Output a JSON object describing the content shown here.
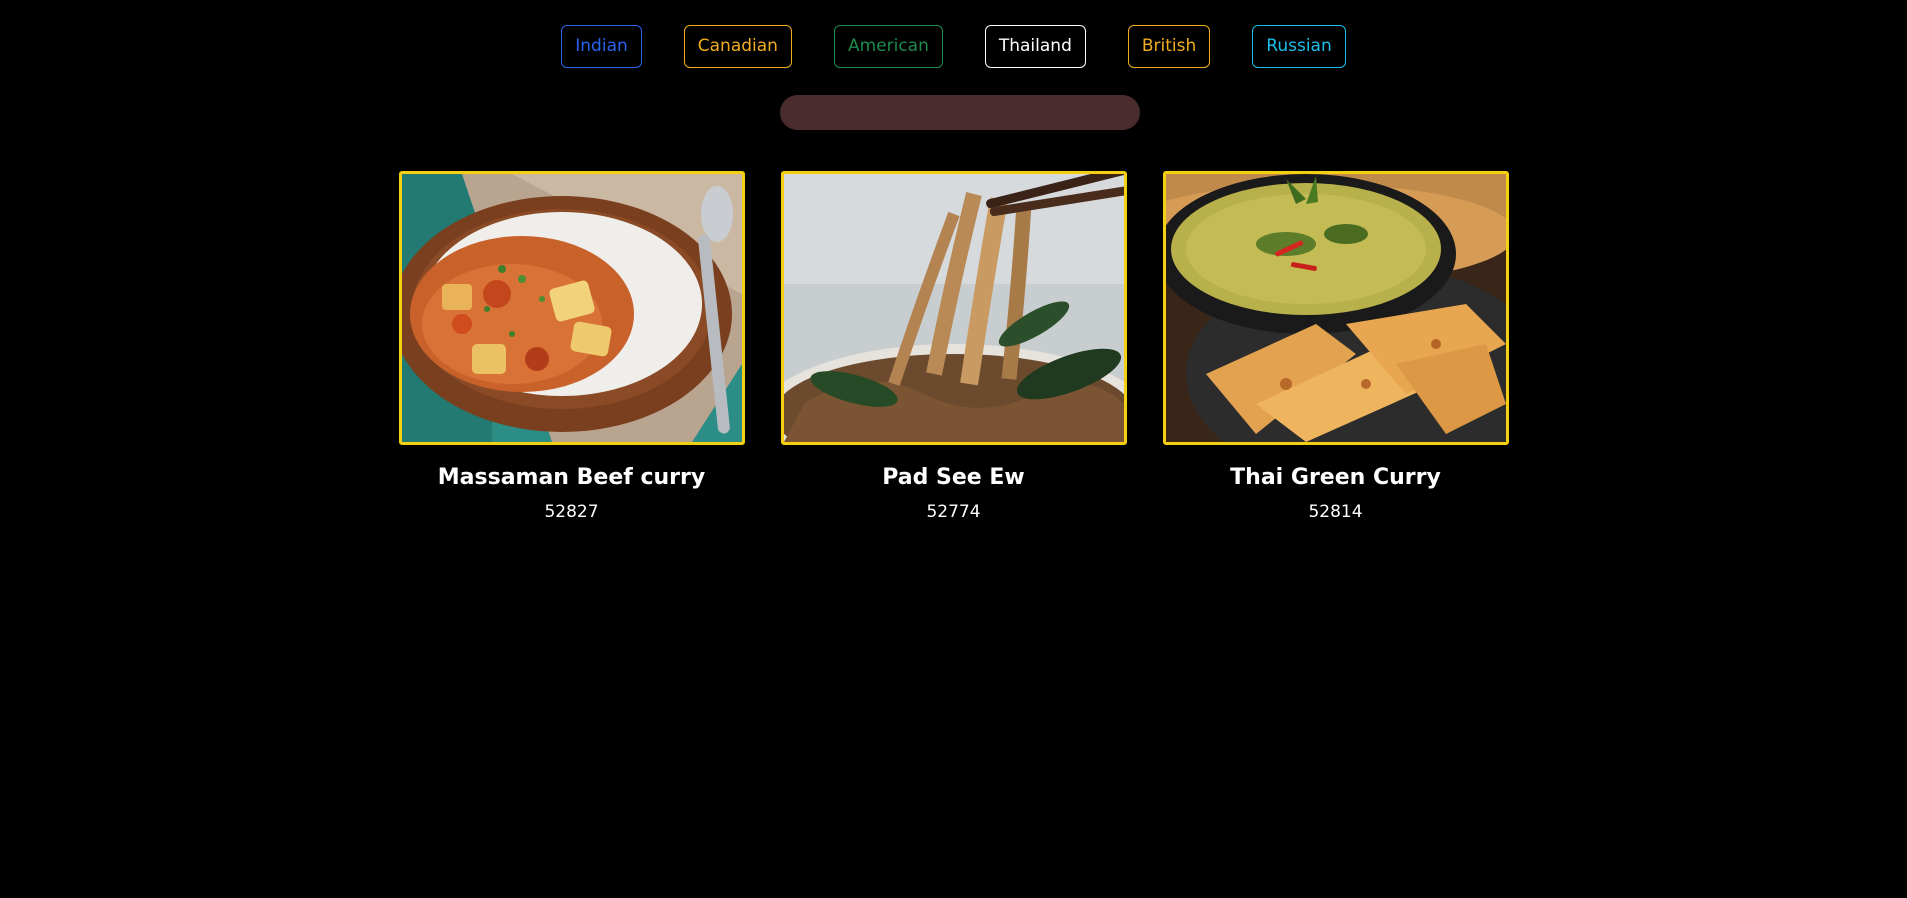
{
  "filters": [
    {
      "label": "Indian",
      "color": "#2a63f0"
    },
    {
      "label": "Canadian",
      "color": "#f0ad1e"
    },
    {
      "label": "American",
      "color": "#1d8a4e"
    },
    {
      "label": "Thailand",
      "color": "#ffffff"
    },
    {
      "label": "British",
      "color": "#f0ad1e"
    },
    {
      "label": "Russian",
      "color": "#1cbfe8"
    }
  ],
  "search": {
    "value": "",
    "placeholder": ""
  },
  "meals": [
    {
      "title": "Massaman Beef curry",
      "id": "52827"
    },
    {
      "title": "Pad See Ew",
      "id": "52774"
    },
    {
      "title": "Thai Green Curry",
      "id": "52814"
    }
  ],
  "colors": {
    "background": "#000000",
    "card_border": "#f5cf12",
    "search_bg": "#4a2c2e"
  }
}
